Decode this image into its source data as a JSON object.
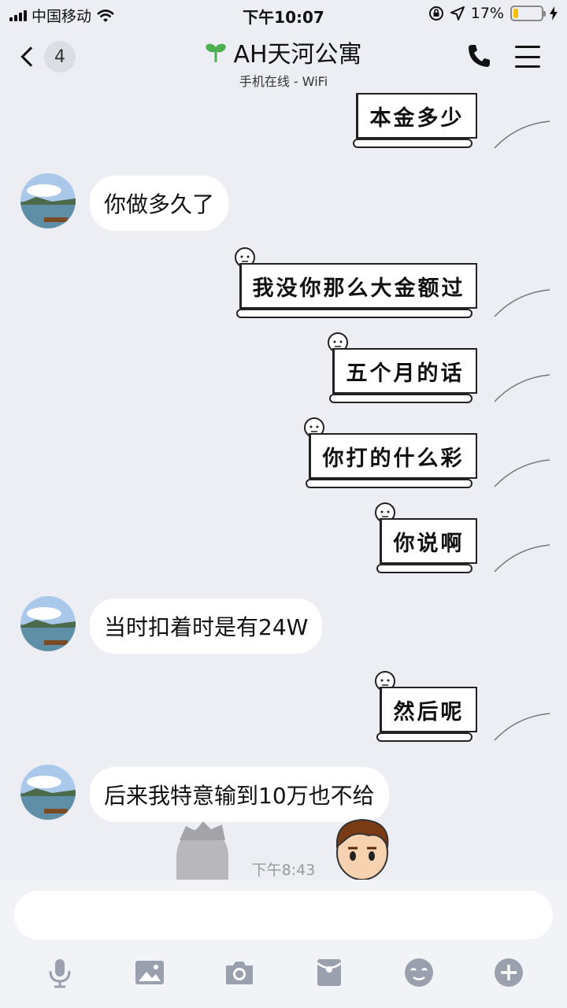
{
  "status_bar": {
    "carrier": "中国移动",
    "time": "下午10:07",
    "battery": "17%",
    "battery_level": 0.17
  },
  "header": {
    "back_count": "4",
    "title": "AH天河公寓",
    "subtitle": "手机在线 - WiFi"
  },
  "messages": [
    {
      "side": "right",
      "style": "scroll",
      "text": "本金多少"
    },
    {
      "side": "left",
      "text": "你做多久了"
    },
    {
      "side": "right",
      "style": "scroll",
      "text": "我没你那么大金额过"
    },
    {
      "side": "right",
      "style": "scroll",
      "text": "五个月的话"
    },
    {
      "side": "right",
      "style": "scroll",
      "text": "你打的什么彩"
    },
    {
      "side": "right",
      "style": "scroll",
      "text": "你说啊"
    },
    {
      "side": "left",
      "text": "当时扣着时是有24W"
    },
    {
      "side": "right",
      "style": "scroll",
      "text": "然后呢"
    },
    {
      "side": "left",
      "text": "后来我特意输到10万也不给"
    }
  ],
  "timestamp": "下午8:43",
  "input": {
    "value": "",
    "placeholder": ""
  },
  "toolbar_icons": [
    "microphone-icon",
    "image-icon",
    "camera-icon",
    "red-packet-icon",
    "emoji-icon",
    "plus-icon"
  ],
  "colors": {
    "background": "#eceef4",
    "bubble": "#ffffff",
    "accent_green": "#4caf50",
    "battery": "#f4c20d"
  }
}
